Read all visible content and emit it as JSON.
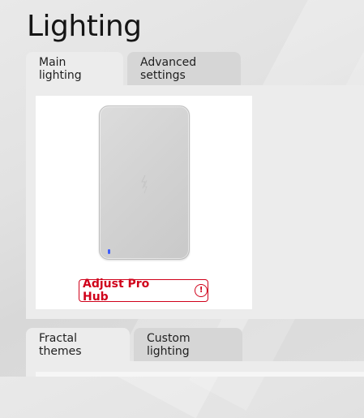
{
  "page": {
    "title": "Lighting"
  },
  "top_tabs": [
    {
      "label": "Main lighting",
      "active": true
    },
    {
      "label": "Advanced settings",
      "active": false
    }
  ],
  "device_card": {
    "adjust_button_label": "Adjust Pro Hub",
    "alert_icon": "!",
    "device_icon": "hub-device",
    "led_color": "#3a5bff"
  },
  "bottom_tabs": [
    {
      "label": "Fractal themes",
      "active": true
    },
    {
      "label": "Custom lighting",
      "active": false
    }
  ],
  "colors": {
    "accent": "#d0021b"
  }
}
